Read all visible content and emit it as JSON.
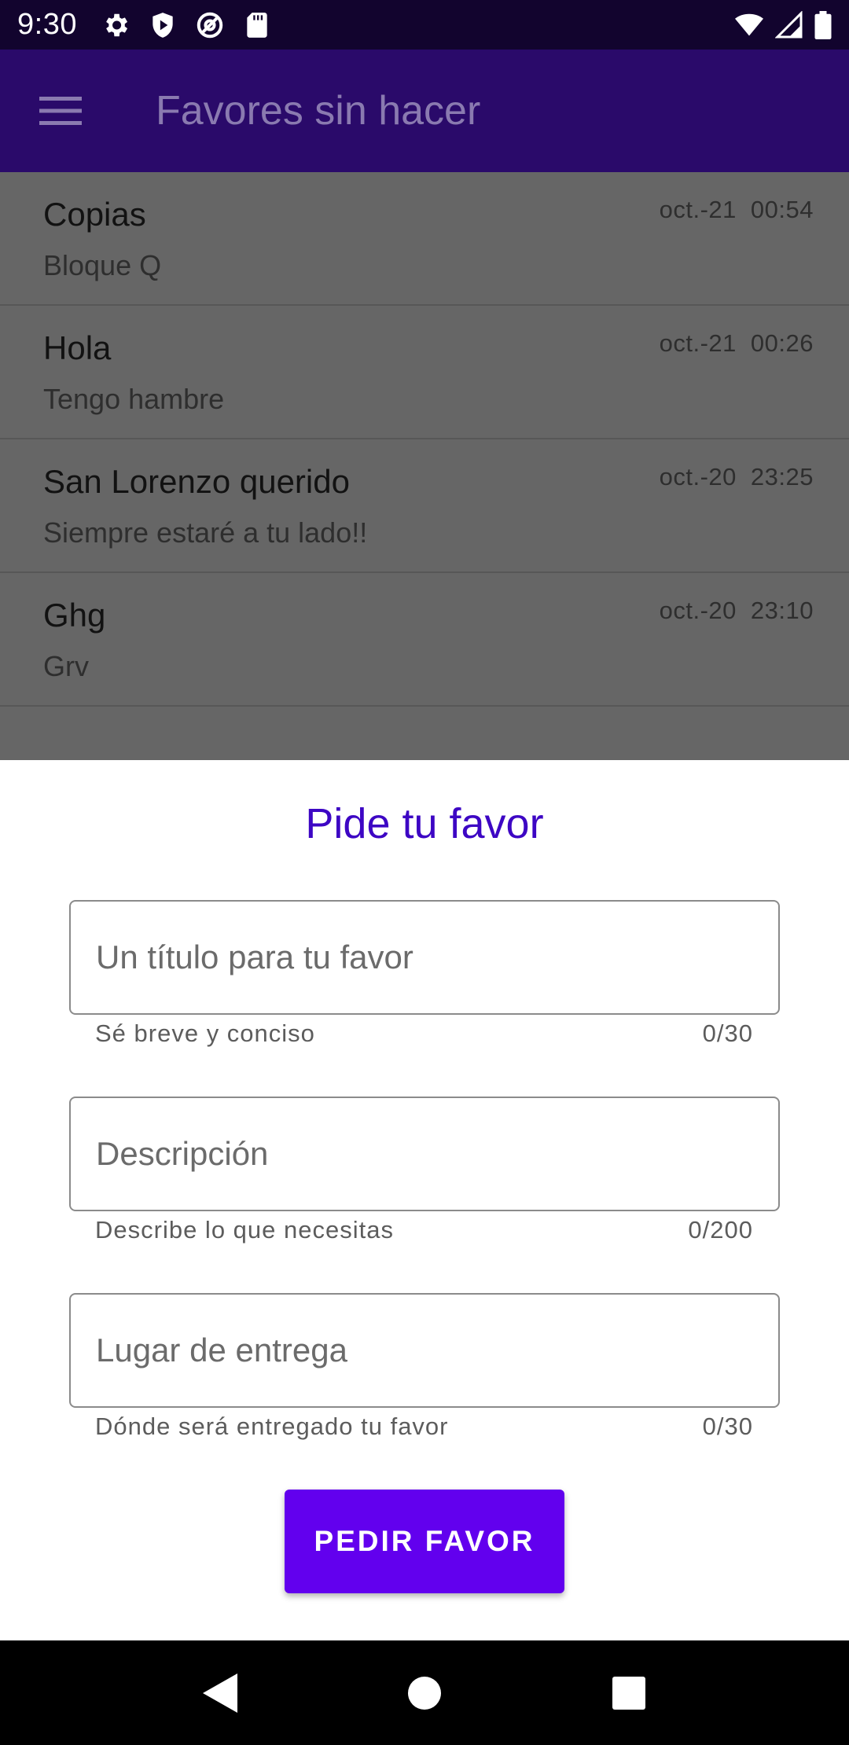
{
  "status_bar": {
    "time": "9:30",
    "left_icons": [
      "gear-icon",
      "shield-icon",
      "at-sign-icon",
      "sd-card-icon"
    ],
    "right_icons": [
      "wifi-icon",
      "signal-icon",
      "battery-icon"
    ]
  },
  "app_bar": {
    "menu_icon": "hamburger-menu-icon",
    "title": "Favores sin hacer"
  },
  "favors": [
    {
      "title": "Copias",
      "subtitle": "Bloque Q",
      "date": "oct.-21",
      "time": "00:54"
    },
    {
      "title": "Hola",
      "subtitle": "Tengo hambre",
      "date": "oct.-21",
      "time": "00:26"
    },
    {
      "title": "San Lorenzo querido",
      "subtitle": "Siempre estaré a tu lado!!",
      "date": "oct.-20",
      "time": "23:25"
    },
    {
      "title": "Ghg",
      "subtitle": "Grv",
      "date": "oct.-20",
      "time": "23:10"
    }
  ],
  "sheet": {
    "title": "Pide tu favor",
    "fields": {
      "title": {
        "placeholder": "Un título para tu favor",
        "value": "",
        "helper": "Sé breve y conciso",
        "counter": "0/30"
      },
      "description": {
        "placeholder": "Descripción",
        "value": "",
        "helper": "Describe lo que necesitas",
        "counter": "0/200"
      },
      "location": {
        "placeholder": "Lugar de entrega",
        "value": "",
        "helper": "Dónde será entregado tu favor",
        "counter": "0/30"
      }
    },
    "submit_label": "PEDIR FAVOR"
  },
  "nav_bar": {
    "icons": [
      "back-icon",
      "home-icon",
      "recents-icon"
    ]
  },
  "colors": {
    "status_bar": "#12042e",
    "app_bar": "#2a0a6a",
    "accent": "#6200ee",
    "sheet_title": "#3d06c4",
    "scrim_list": "#666666"
  }
}
